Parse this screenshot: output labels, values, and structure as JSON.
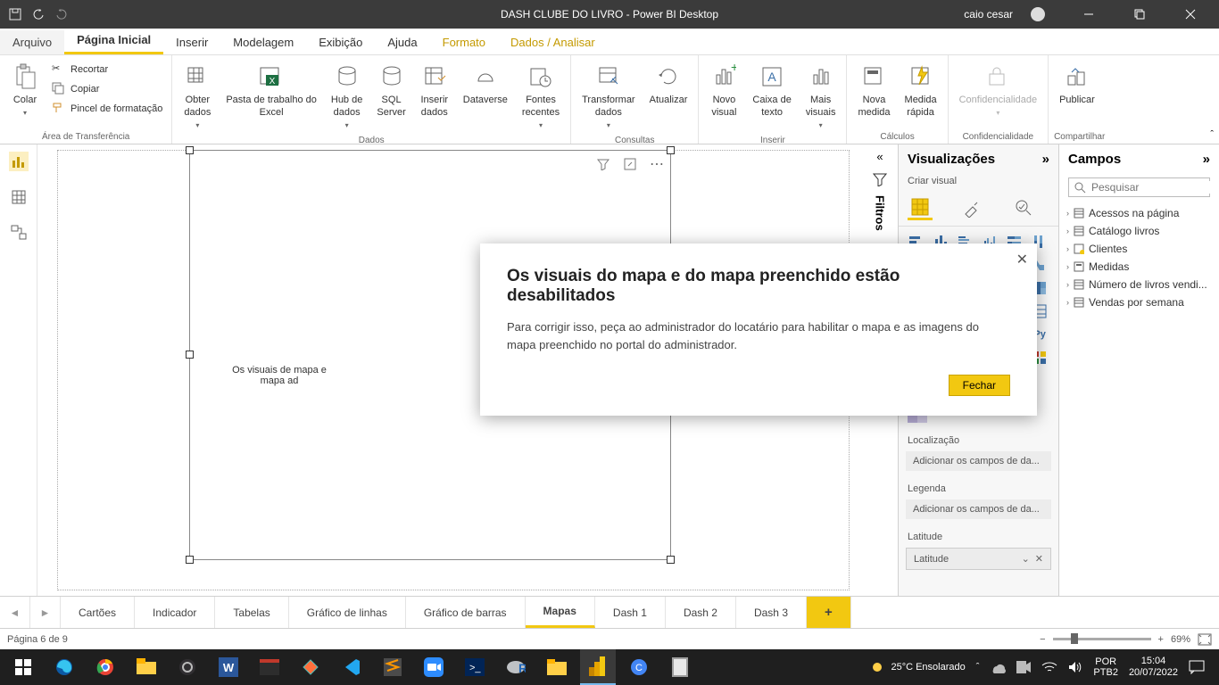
{
  "titlebar": {
    "title": "DASH CLUBE DO LIVRO - Power BI Desktop",
    "user": "caio cesar"
  },
  "menu": {
    "arquivo": "Arquivo",
    "pagina_inicial": "Página Inicial",
    "inserir": "Inserir",
    "modelagem": "Modelagem",
    "exibicao": "Exibição",
    "ajuda": "Ajuda",
    "formato": "Formato",
    "dados_analisar": "Dados / Analisar"
  },
  "ribbon": {
    "colar": "Colar",
    "recortar": "Recortar",
    "copiar": "Copiar",
    "pincel": "Pincel de formatação",
    "grp_area": "Área de Transferência",
    "obter": "Obter\ndados",
    "excel": "Pasta de trabalho do\nExcel",
    "hub": "Hub de\ndados",
    "sql": "SQL\nServer",
    "inserir_dados": "Inserir\ndados",
    "dataverse": "Dataverse",
    "fontes": "Fontes\nrecentes",
    "grp_dados": "Dados",
    "transformar": "Transformar\ndados",
    "atualizar": "Atualizar",
    "grp_consultas": "Consultas",
    "novo_visual": "Novo\nvisual",
    "caixa": "Caixa de\ntexto",
    "mais_visuais": "Mais\nvisuais",
    "grp_inserir": "Inserir",
    "nova_medida": "Nova\nmedida",
    "medida_rapida": "Medida\nrápida",
    "grp_calculos": "Cálculos",
    "confidencialidade": "Confidencialidade",
    "grp_conf": "Confidencialidade",
    "publicar": "Publicar",
    "grp_comp": "Compartilhar"
  },
  "filters_label": "Filtros",
  "canvas_msg": "Os visuais de mapa e mapa ad",
  "dialog": {
    "title": "Os visuais do mapa e do mapa preenchido estão desabilitados",
    "body": "Para corrigir isso, peça ao administrador do locatário para habilitar o mapa e as imagens do mapa preenchido no portal do administrador.",
    "close": "Fechar"
  },
  "viz_pane": {
    "title": "Visualizações",
    "sub": "Criar visual",
    "sec_localizacao": "Localização",
    "well_loc": "Adicionar os campos de da...",
    "sec_legenda": "Legenda",
    "well_leg": "Adicionar os campos de da...",
    "sec_lat": "Latitude",
    "well_lat": "Latitude"
  },
  "fields_pane": {
    "title": "Campos",
    "search_ph": "Pesquisar",
    "tables": [
      "Acessos na página",
      "Catálogo livros",
      "Clientes",
      "Medidas",
      "Número de livros vendi...",
      "Vendas por semana"
    ]
  },
  "tabs": [
    "Cartões",
    "Indicador",
    "Tabelas",
    "Gráfico de linhas",
    "Gráfico de barras",
    "Mapas",
    "Dash 1",
    "Dash 2",
    "Dash 3"
  ],
  "active_tab": "Mapas",
  "status": {
    "page": "Página 6 de 9",
    "zoom": "69%"
  },
  "taskbar": {
    "weather": "25°C  Ensolarado",
    "kbd1": "POR",
    "kbd2": "PTB2",
    "time": "15:04",
    "date": "20/07/2022"
  }
}
